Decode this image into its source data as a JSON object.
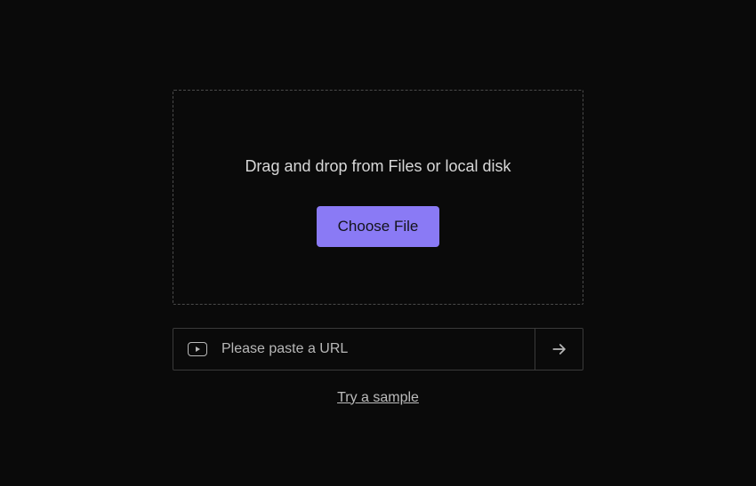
{
  "dropzone": {
    "text": "Drag and drop from Files or local disk",
    "button_label": "Choose File"
  },
  "url_input": {
    "placeholder": "Please paste a URL"
  },
  "sample_link": {
    "label": "Try a sample"
  }
}
